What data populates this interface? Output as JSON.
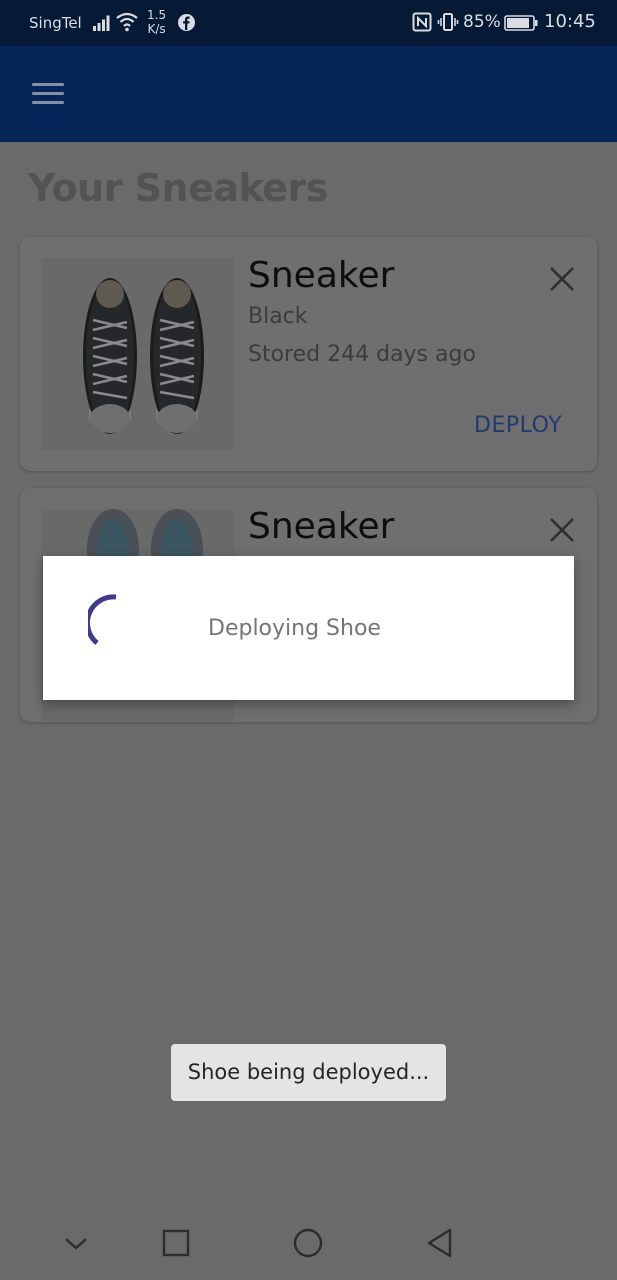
{
  "status_bar": {
    "carrier": "SingTel",
    "speed_value": "1.5",
    "speed_unit": "K/s",
    "battery_percent": "85%",
    "time": "10:45",
    "icons": [
      "signal-icon",
      "wifi-icon",
      "facebook-icon",
      "nfc-icon",
      "vibrate-icon",
      "battery-icon"
    ]
  },
  "app_bar": {
    "menu_icon": "hamburger-menu-icon"
  },
  "page": {
    "title": "Your Sneakers"
  },
  "cards": [
    {
      "title": "Sneaker",
      "color": "Black",
      "stored": "Stored 244 days ago",
      "action": "DEPLOY"
    },
    {
      "title": "Sneaker"
    }
  ],
  "dialog": {
    "message": "Deploying Shoe",
    "spinner_color": "#3f3a8f"
  },
  "toast": {
    "message": "Shoe being deployed..."
  },
  "colors": {
    "status_bar": "#061a36",
    "app_bar": "#062457",
    "scrim": "#6a6a6a",
    "deploy": "#233871"
  },
  "nav_bar": {
    "icons": [
      "chevron-down-icon",
      "recents-icon",
      "home-icon",
      "back-icon"
    ]
  }
}
